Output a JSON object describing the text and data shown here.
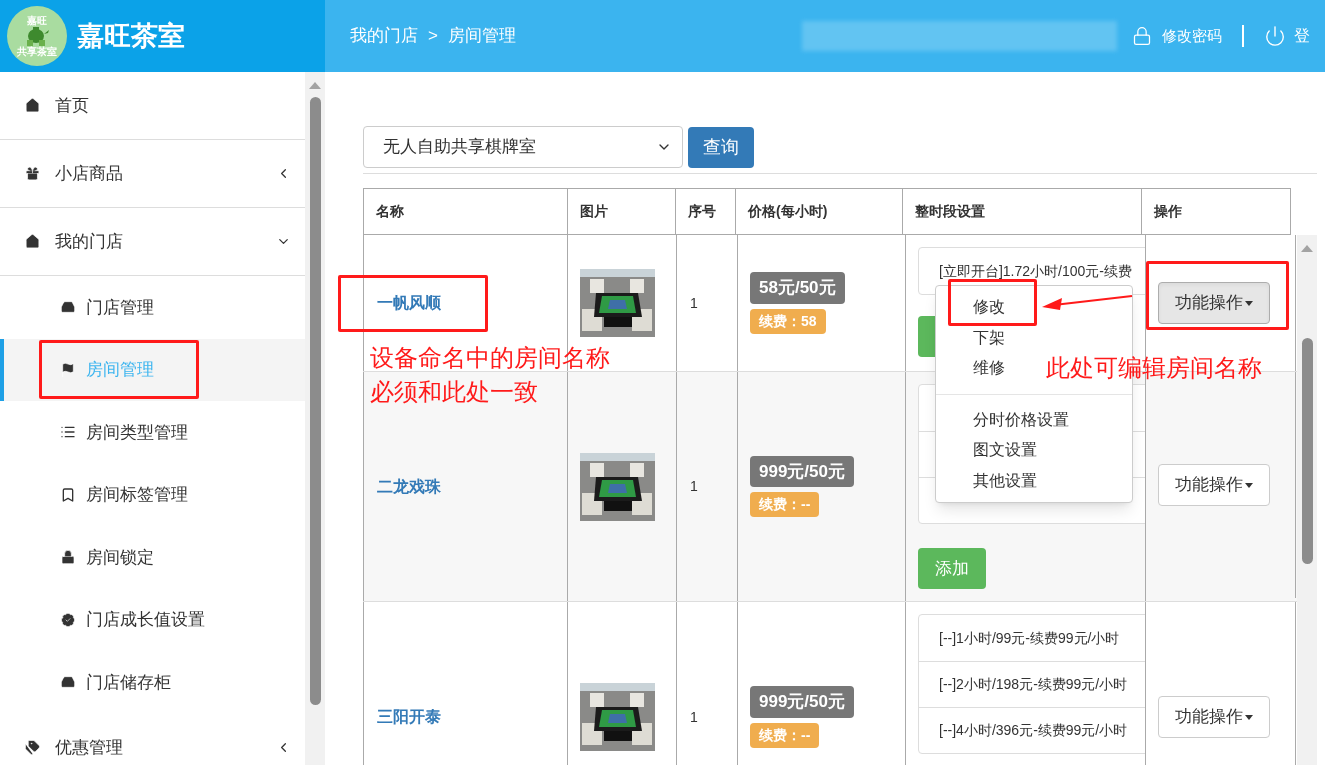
{
  "header": {
    "logo_top": "嘉旺",
    "logo_bottom": "共享茶室",
    "brand": "嘉旺茶室",
    "breadcrumb": [
      "我的门店",
      "房间管理"
    ],
    "breadcrumb_separator": ">",
    "change_password": "修改密码",
    "logout": "登"
  },
  "sidebar": {
    "items": [
      {
        "label": "首页",
        "kind": "link"
      },
      {
        "label": "小店商品",
        "kind": "group",
        "expanded": false
      },
      {
        "label": "我的门店",
        "kind": "group",
        "expanded": true,
        "children": [
          {
            "label": "门店管理",
            "selected": false
          },
          {
            "label": "房间管理",
            "selected": true
          },
          {
            "label": "房间类型管理",
            "selected": false
          },
          {
            "label": "房间标签管理",
            "selected": false
          },
          {
            "label": "房间锁定",
            "selected": false
          },
          {
            "label": "门店成长值设置",
            "selected": false
          },
          {
            "label": "门店储存柜",
            "selected": false
          }
        ]
      },
      {
        "label": "优惠管理",
        "kind": "group",
        "expanded": false
      }
    ]
  },
  "filter": {
    "select_value": "无人自助共享棋牌室",
    "query_button": "查询"
  },
  "table": {
    "columns": [
      "名称",
      "图片",
      "序号",
      "价格(每小时)",
      "整时段设置",
      "操作"
    ],
    "rows": [
      {
        "name": "一帆风顺",
        "picture": {
          "kind": "picture"
        },
        "seq": "1",
        "price": "58元/50元",
        "renew": "续费：58",
        "slots": [
          {
            "kind": "text",
            "text": "[立即开台]1.72小时/100元-续费"
          }
        ],
        "add_button": {
          "kind": "covered"
        },
        "action": {
          "label": "功能操作",
          "expanded": true,
          "menu": [
            {
              "kind": "item",
              "label": "修改"
            },
            {
              "kind": "item",
              "label": "下架"
            },
            {
              "kind": "item",
              "label": "维修"
            },
            {
              "kind": "divider"
            },
            {
              "kind": "item",
              "label": "分时价格设置"
            },
            {
              "kind": "item",
              "label": "图文设置"
            },
            {
              "kind": "item",
              "label": "其他设置"
            }
          ]
        }
      },
      {
        "name": "二龙戏珠",
        "picture": {
          "kind": "picture"
        },
        "seq": "1",
        "price": "999元/50元",
        "renew": "续费：--",
        "slots": [
          {
            "kind": "covered"
          },
          {
            "kind": "covered"
          },
          {
            "kind": "covered"
          }
        ],
        "add_button": {
          "kind": "button",
          "label": "添加"
        },
        "action": {
          "label": "功能操作",
          "expanded": false
        }
      },
      {
        "name": "三阳开泰",
        "picture": {
          "kind": "picture"
        },
        "seq": "1",
        "price": "999元/50元",
        "renew": "续费：--",
        "slots": [
          {
            "kind": "text",
            "text": "[--]1小时/99元-续费99元/小时"
          },
          {
            "kind": "text",
            "text": "[--]2小时/198元-续费99元/小时"
          },
          {
            "kind": "text",
            "text": "[--]4小时/396元-续费99元/小时"
          }
        ],
        "action": {
          "label": "功能操作",
          "expanded": false
        }
      }
    ]
  },
  "annotations": {
    "name_note": [
      "设备命名中的房间名称",
      "必须和此处一致"
    ],
    "edit_note": "此处可编辑房间名称"
  }
}
